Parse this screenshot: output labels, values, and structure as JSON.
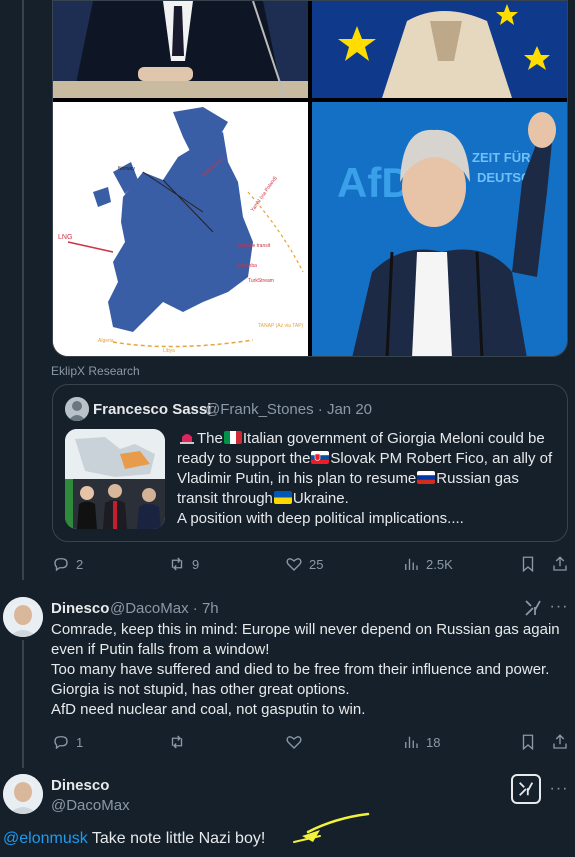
{
  "media": {
    "map_labels": [
      "Norway",
      "LNG",
      "Algeria",
      "Libya",
      "Ukraine transit",
      "Nord Stream",
      "Yamal (via Poland)",
      "TurkStream",
      "Druzhba",
      "TANAP (Az via TAP)"
    ],
    "afd_sign": "AfD",
    "banner_text": [
      "ZEIT FÜR",
      "DEUTSCH"
    ]
  },
  "attribution": "EklipX Research",
  "quote": {
    "name": "Francesco Sassi",
    "handle": "@Frank_Stones",
    "separator": "·",
    "date": "Jan 20",
    "line1_a": "The",
    "line1_b": "Italian government of Giorgia Meloni could be",
    "line2_a": "ready to support the",
    "line2_b": "Slovak PM Robert Fico, an ally of",
    "line3": "Vladimir Putin, in his plan to resume",
    "line3_b": "Russian gas",
    "line4_a": "transit through",
    "line4_b": "Ukraine.",
    "line5": "A position with deep political implications...."
  },
  "tweet_actions": {
    "replies": "2",
    "reposts": "9",
    "likes": "25",
    "views": "2.5K"
  },
  "reply1": {
    "name": "Dinesco",
    "handle": "@DacoMax",
    "separator": "·",
    "time": "7h",
    "lines": [
      "Comrade, keep this in mind: Europe will never depend on Russian gas again",
      "even if Putin falls from a window!",
      "Too many have suffered and died to be free from their influence and power.",
      "Giorgia is not stupid, has other great options.",
      "AfD need nuclear and coal, not gasputin to win."
    ],
    "actions": {
      "replies": "1",
      "reposts": "",
      "likes": "",
      "views": "18"
    }
  },
  "main_reply": {
    "name": "Dinesco",
    "handle": "@DacoMax",
    "mention": "@elonmusk",
    "text": " Take note little Nazi boy!"
  },
  "colors": {
    "background": "#15202b",
    "text": "#e7e9ea",
    "muted": "#8b98a5",
    "accent": "#1d9bf0",
    "annotation_arrow": "#f2f23a"
  }
}
